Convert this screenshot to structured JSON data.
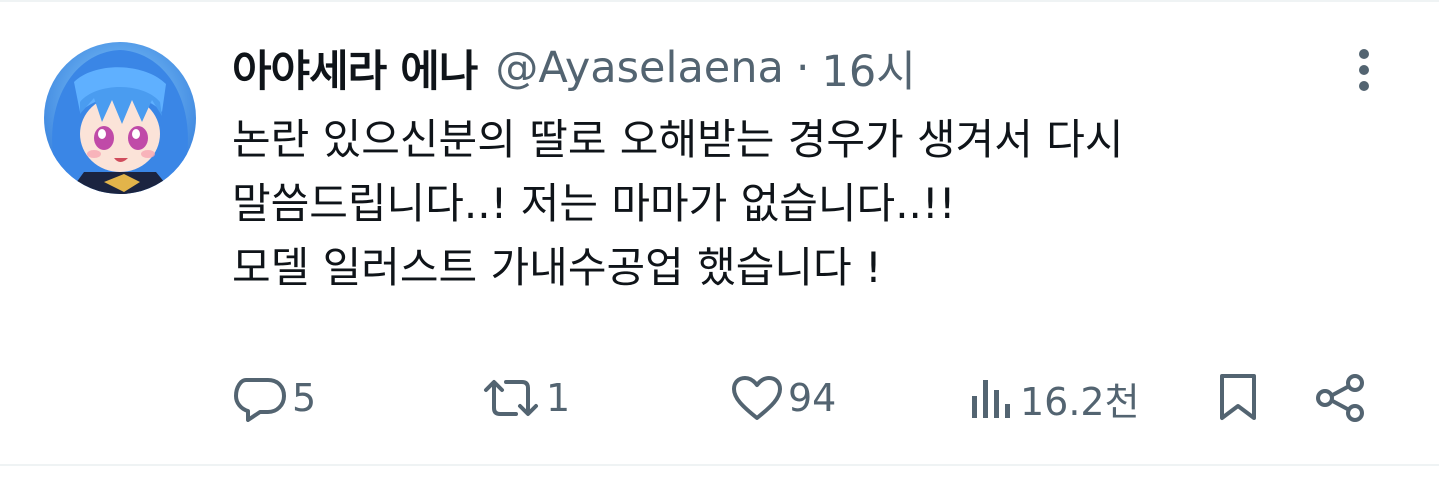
{
  "tweet": {
    "author": {
      "display_name": "아야세라 에나",
      "handle": "@Ayaselaena",
      "separator": "·",
      "timestamp": "16시",
      "avatar_icon": "anime-avatar-icon"
    },
    "text_lines": [
      "논란 있으신분의 딸로 오해받는 경우가 생겨서 다시",
      "말씀드립니다..! 저는 마마가 없습니다..!!",
      "모델 일러스트 가내수공업 했습니다 !"
    ],
    "actions": {
      "reply": {
        "icon": "reply-icon",
        "count": "5"
      },
      "retweet": {
        "icon": "retweet-icon",
        "count": "1"
      },
      "like": {
        "icon": "heart-icon",
        "count": "94"
      },
      "views": {
        "icon": "views-icon",
        "count": "16.2천"
      },
      "bookmark": {
        "icon": "bookmark-icon"
      },
      "share": {
        "icon": "share-icon"
      }
    },
    "more_icon": "more-vertical-icon",
    "colors": {
      "text": "#0f1419",
      "secondary": "#536471",
      "border": "#eff3f4"
    }
  }
}
